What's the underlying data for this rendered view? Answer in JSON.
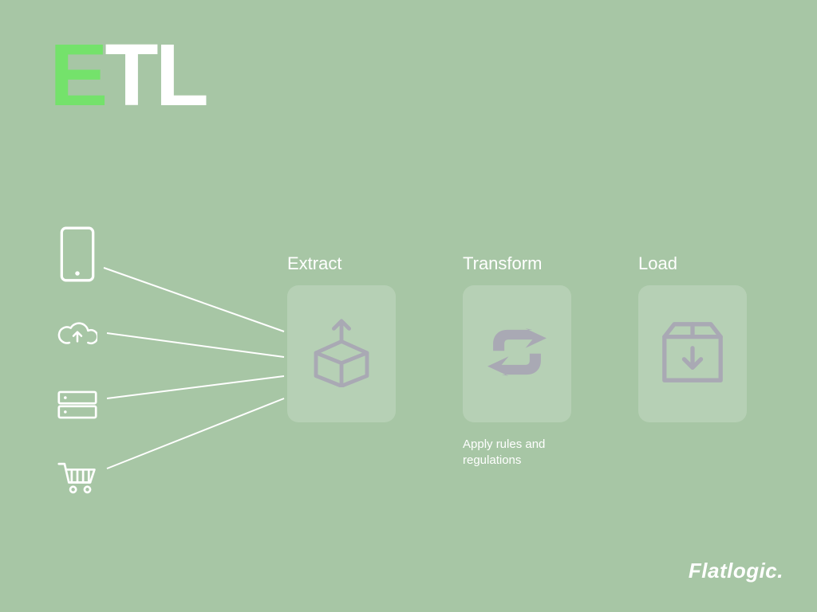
{
  "title": {
    "highlight": "E",
    "rest": "TL"
  },
  "sources": [
    {
      "name": "mobile-icon"
    },
    {
      "name": "cloud-upload-icon"
    },
    {
      "name": "servers-icon"
    },
    {
      "name": "cart-icon"
    }
  ],
  "steps": [
    {
      "label": "Extract",
      "icon": "box-arrow-up-icon",
      "subtext": ""
    },
    {
      "label": "Transform",
      "icon": "cycle-arrows-icon",
      "subtext": "Apply rules and\nregulations"
    },
    {
      "label": "Load",
      "icon": "package-download-icon",
      "subtext": ""
    }
  ],
  "brand": "Flatlogic.",
  "colors": {
    "background": "#a7c6a5",
    "accent_green": "#74e26b",
    "white": "#ffffff",
    "icon_gray": "#a9a9b4",
    "card_bg": "rgba(255,255,255,0.18)"
  }
}
